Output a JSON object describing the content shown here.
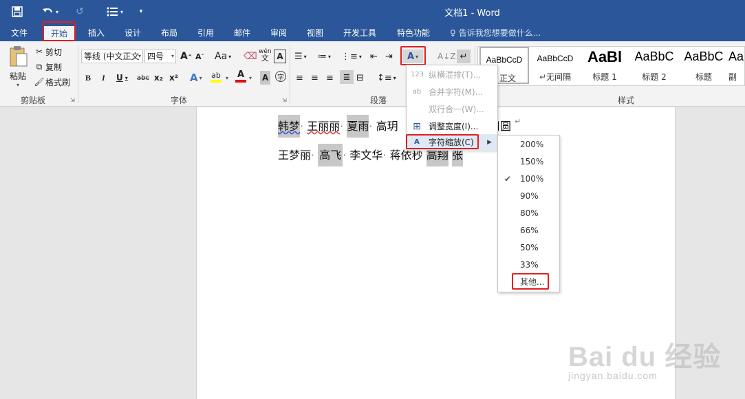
{
  "titlebar": {
    "doc_title": "文档1 - Word",
    "bg_color": "#2b579a"
  },
  "tabs": [
    {
      "label": "文件"
    },
    {
      "label": "开始"
    },
    {
      "label": "插入"
    },
    {
      "label": "设计"
    },
    {
      "label": "布局"
    },
    {
      "label": "引用"
    },
    {
      "label": "邮件"
    },
    {
      "label": "审阅"
    },
    {
      "label": "视图"
    },
    {
      "label": "开发工具"
    },
    {
      "label": "特色功能"
    }
  ],
  "tell_me": "告诉我您想要做什么...",
  "clipboard": {
    "paste": "粘贴",
    "cut": "剪切",
    "copy": "复制",
    "format_painter": "格式刷",
    "group": "剪贴板"
  },
  "font": {
    "font_name": "等线 (中文正文",
    "font_size": "四号",
    "change_case": "Aa",
    "group": "字体",
    "bold": "B",
    "italic": "I",
    "underline": "U",
    "strike": "abc",
    "subscript": "x₂",
    "superscript": "x²"
  },
  "paragraph": {
    "group": "段落"
  },
  "styles": {
    "group": "样式",
    "items": [
      {
        "sample": "AaBbCcD",
        "name": "正文"
      },
      {
        "sample": "AaBbCcD",
        "name": "无间隔"
      },
      {
        "sample": "AaBl",
        "name": "标题 1"
      },
      {
        "sample": "AaBbC",
        "name": "标题 2"
      },
      {
        "sample": "AaBbC",
        "name": "标题"
      },
      {
        "sample": "Aa",
        "name": "副"
      }
    ]
  },
  "document": {
    "line1": [
      "韩梦",
      "王丽丽",
      "夏雨",
      "高玥",
      "周圆"
    ],
    "line2": [
      "王梦丽",
      "高飞",
      "李文华",
      "蒋依秒",
      "高翔",
      "张"
    ]
  },
  "menu": {
    "items": [
      {
        "label": "纵横混排(T)...",
        "disabled": true
      },
      {
        "label": "合并字符(M)...",
        "disabled": true
      },
      {
        "label": "双行合一(W)...",
        "disabled": true
      },
      {
        "label": "调整宽度(I)...",
        "disabled": false
      },
      {
        "label": "字符缩放(C)",
        "disabled": false
      }
    ]
  },
  "submenu": {
    "items": [
      "200%",
      "150%",
      "100%",
      "90%",
      "80%",
      "66%",
      "50%",
      "33%",
      "其他..."
    ],
    "checked": "100%"
  },
  "watermark": {
    "main": "Bai du 经验",
    "sub": "jingyan.baidu.com"
  },
  "highlight_color": "#e02020"
}
